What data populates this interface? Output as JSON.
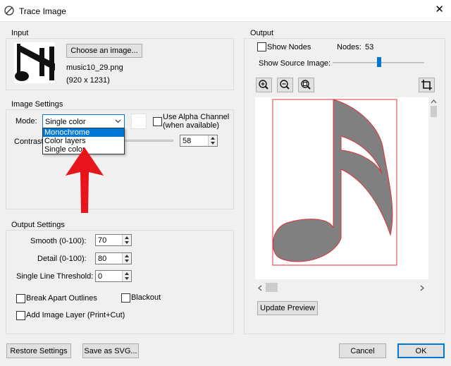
{
  "window": {
    "title": "Trace Image",
    "close_glyph": "✕"
  },
  "input": {
    "group_label": "Input",
    "choose_button": "Choose an image...",
    "filename": "music10_29.png",
    "dimensions": "(920 x 1231)"
  },
  "image_settings": {
    "group_label": "Image Settings",
    "mode_label": "Mode:",
    "mode_value": "Single color",
    "mode_options": [
      "Monochrome",
      "Color layers",
      "Single color"
    ],
    "highlighted_option": "Monochrome",
    "alpha_label_1": "Use Alpha Channel",
    "alpha_label_2": "(when available)",
    "contrast_label": "Contrast",
    "contrast_value": "58"
  },
  "output_settings": {
    "group_label": "Output Settings",
    "smooth_label": "Smooth (0-100):",
    "smooth_value": "70",
    "detail_label": "Detail (0-100):",
    "detail_value": "80",
    "threshold_label": "Single Line Threshold:",
    "threshold_value": "0",
    "break_apart_label": "Break Apart Outlines",
    "blackout_label": "Blackout",
    "add_image_label": "Add Image Layer (Print+Cut)"
  },
  "output": {
    "group_label": "Output",
    "show_nodes_label": "Show Nodes",
    "nodes_label": "Nodes:",
    "nodes_value": "53",
    "show_source_label": "Show Source Image:",
    "update_preview": "Update Preview"
  },
  "footer": {
    "restore": "Restore Settings",
    "save_svg": "Save as SVG...",
    "cancel": "Cancel",
    "ok": "OK"
  },
  "colors": {
    "accent": "#0078d7",
    "arrow": "#e8141c",
    "trace_outline": "#e0303a",
    "note_fill": "#808080"
  }
}
